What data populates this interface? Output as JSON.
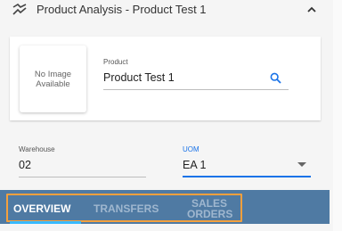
{
  "panel": {
    "title": "Product Analysis - Product Test 1",
    "icon": "trend-icon",
    "collapse_icon": "chevron-up-icon"
  },
  "product": {
    "image_placeholder": "No Image Available",
    "label": "Product",
    "value": "Product Test 1",
    "search_icon": "search-icon"
  },
  "warehouse": {
    "label": "Warehouse",
    "value": "02"
  },
  "uom": {
    "label": "UOM",
    "value": "EA 1"
  },
  "tabs": [
    {
      "label": "OVERVIEW",
      "active": true
    },
    {
      "label": "TRANSFERS",
      "active": false
    },
    {
      "label": "SALES ORDERS",
      "active": false
    }
  ],
  "colors": {
    "accent": "#1a73e8",
    "tabbar": "#4f7aa3",
    "highlight": "#f4a03d",
    "active_underline": "#37b9ff"
  }
}
